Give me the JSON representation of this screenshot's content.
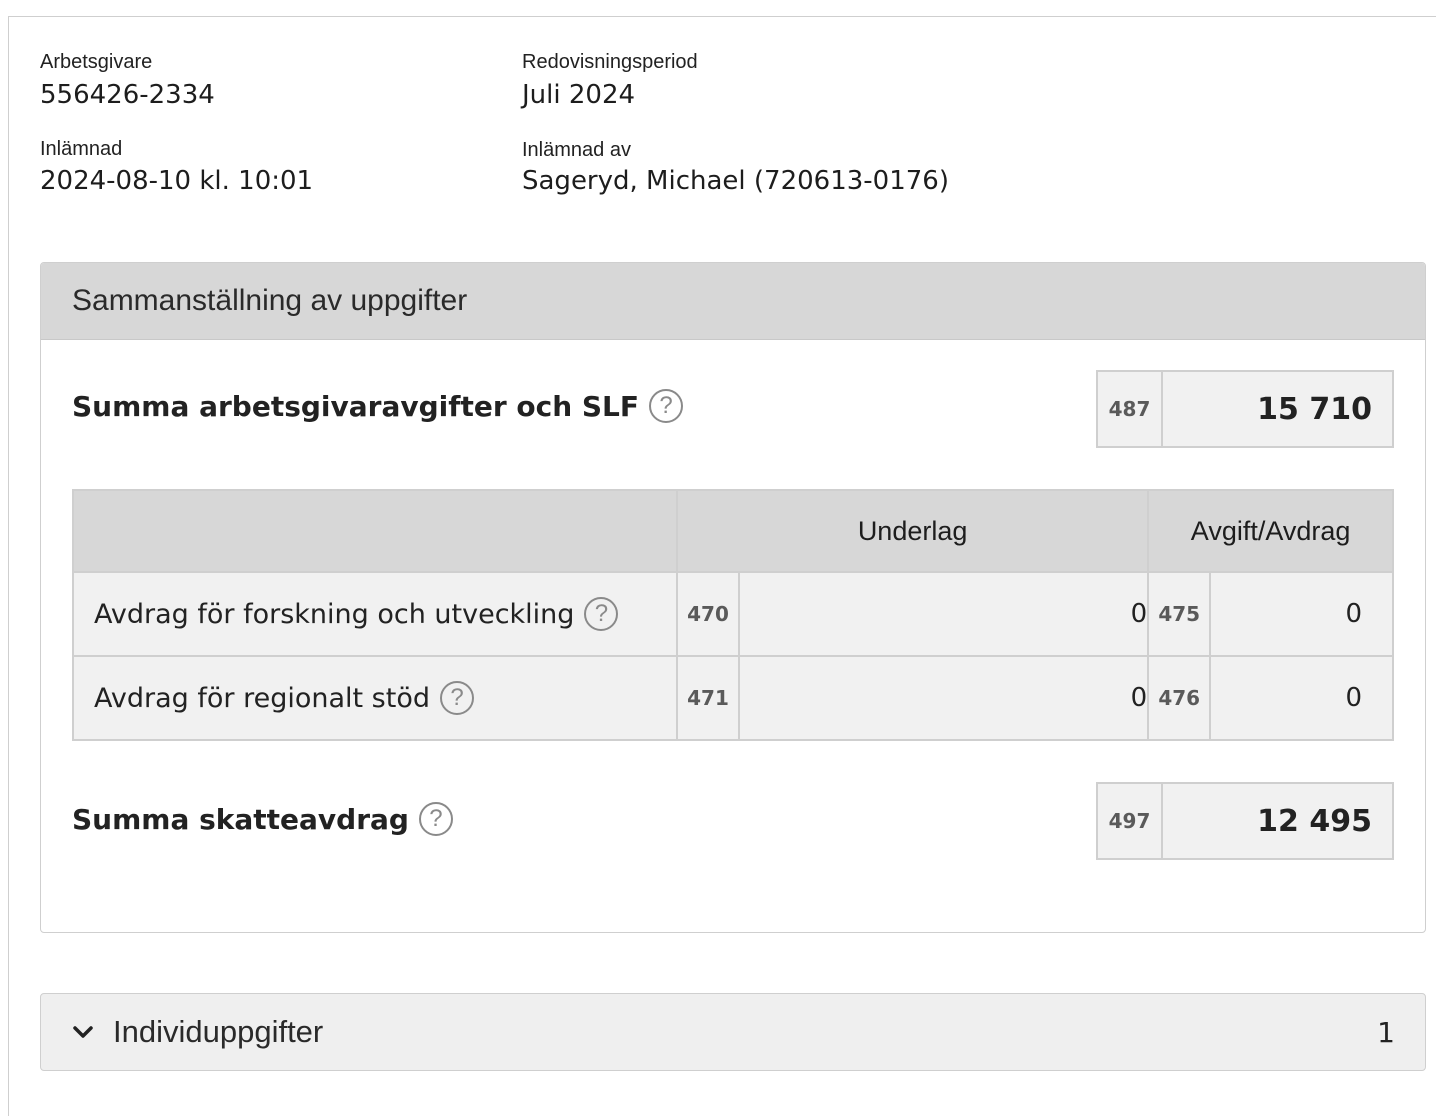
{
  "meta": {
    "employer_label": "Arbetsgivare",
    "employer_value": "556426-2334",
    "period_label": "Redovisningsperiod",
    "period_value": "Juli 2024",
    "submitted_label": "Inlämnad",
    "submitted_value": "2024-08-10 kl. 10:01",
    "submitted_by_label": "Inlämnad av",
    "submitted_by_value": "Sageryd, Michael (720613-0176)"
  },
  "summary": {
    "title": "Sammanställning av uppgifter",
    "fees_label": "Summa arbetsgivaravgifter och SLF",
    "fees_code": "487",
    "fees_value": "15 710",
    "table": {
      "headers": [
        "",
        "Underlag",
        "Avgift/Avdrag"
      ],
      "rows": [
        {
          "label": "Avdrag för forskning och utveckling",
          "code1": "470",
          "value1": "0",
          "code2": "475",
          "value2": "0"
        },
        {
          "label": "Avdrag för regionalt stöd",
          "code1": "471",
          "value1": "0",
          "code2": "476",
          "value2": "0"
        }
      ]
    },
    "tax_label": "Summa skatteavdrag",
    "tax_code": "497",
    "tax_value": "12 495",
    "help_glyph": "?"
  },
  "individ": {
    "title": "Individuppgifter",
    "count": "1",
    "icon": "chevron-down-icon"
  }
}
